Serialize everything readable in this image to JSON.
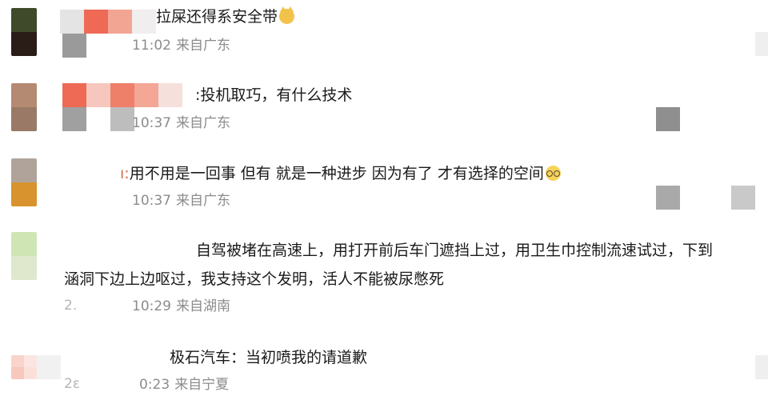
{
  "comments": [
    {
      "text": "拉屎还得系安全带",
      "emoji": "cat-grin-icon",
      "time": "11:02",
      "location": "来自广东"
    },
    {
      "text": "投机取巧，有什么技术",
      "time": "10:37",
      "location": "来自广东"
    },
    {
      "text": "用不用是一回事 但有 就是一种进步 因为有了 才有选择的空间",
      "emoji": "nerd-glasses-icon",
      "time": "10:37",
      "location": "来自广东"
    },
    {
      "text_line1": "自驾被堵在高速上，用打开前后车门遮挡上过，用卫生巾控制流速试过，下到",
      "text_line2": "涵洞下边上边呕过，我支持这个发明，活人不能被尿憋死",
      "time": "10:29",
      "location": "来自湖南"
    },
    {
      "text": "极石汽车：当初喷我的请道歉",
      "time": "0:23",
      "location": "来自宁夏"
    }
  ],
  "colors": {
    "text": "#1a1a1a",
    "meta": "#8c8c8c",
    "mosaic_red": "#ee6a55",
    "mosaic_pink": "#f4a697",
    "mosaic_gray": "#8a8a8a"
  }
}
